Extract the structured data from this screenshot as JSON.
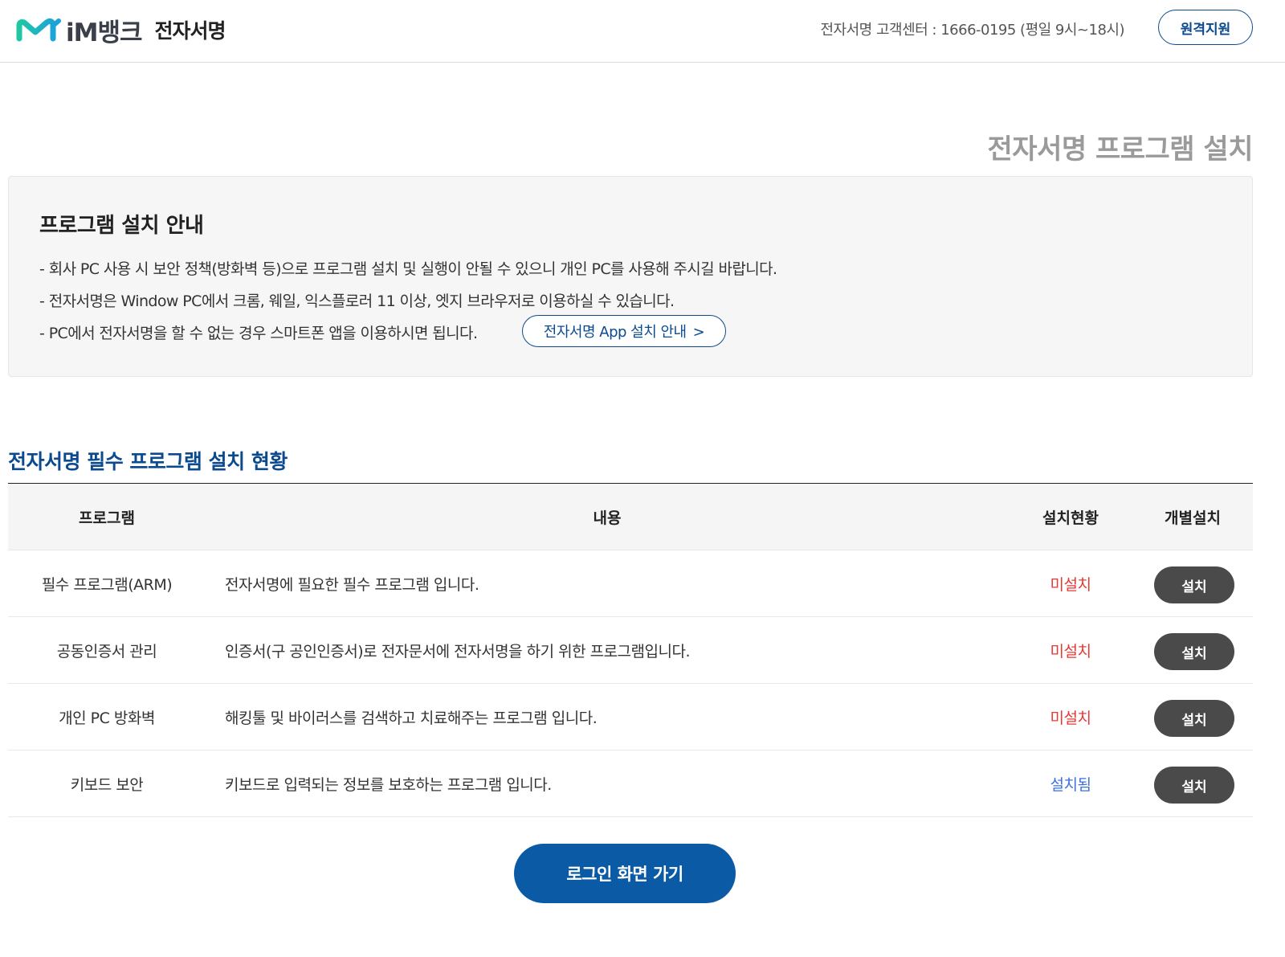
{
  "header": {
    "brand_name": "iM뱅크",
    "brand_sub": "전자서명",
    "support_text": "전자서명 고객센터 : 1666-0195 (평일 9시~18시)",
    "remote_support_label": "원격지원",
    "logo_colors": [
      "#1fc7a5",
      "#1aa5d8"
    ]
  },
  "page_title": "전자서명 프로그램 설치",
  "notice": {
    "title": "프로그램 설치 안내",
    "lines": [
      "- 회사 PC 사용 시 보안 정책(방화벽 등)으로 프로그램 설치 및 실행이 안될 수 있으니 개인 PC를 사용해 주시길 바랍니다.",
      "- 전자서명은 Window PC에서 크롬, 웨일, 익스플로러 11 이상, 엣지 브라우저로 이용하실 수 있습니다.",
      "- PC에서 전자서명을 할 수 없는 경우 스마트폰 앱을 이용하시면 됩니다."
    ],
    "app_guide_label": "전자서명 App 설치 안내",
    "app_guide_chevron": ">"
  },
  "section_title": "전자서명 필수 프로그램 설치 현황",
  "table": {
    "headers": [
      "프로그램",
      "내용",
      "설치현황",
      "개별설치"
    ],
    "rows": [
      {
        "program": "필수 프로그램(ARM)",
        "description": "전자서명에 필요한 필수 프로그램 입니다.",
        "status": "미설치",
        "action": "설치"
      },
      {
        "program": "공동인증서 관리",
        "description": "인증서(구 공인인증서)로 전자문서에 전자서명을 하기 위한 프로그램입니다.",
        "status": "미설치",
        "action": "설치"
      },
      {
        "program": "개인 PC 방화벽",
        "description": "해킹툴 및 바이러스를 검색하고 치료해주는 프로그램 입니다.",
        "status": "미설치",
        "action": "설치"
      },
      {
        "program": "키보드 보안",
        "description": "키보드로 입력되는 정보를 보호하는 프로그램 입니다.",
        "status": "설치됨",
        "action": "설치"
      }
    ],
    "status_colors": {
      "not_installed": "#e53935",
      "installed": "#3f6fe0"
    }
  },
  "login_button_label": "로그인 화면 가기",
  "accent_color": "#0b4a8f"
}
